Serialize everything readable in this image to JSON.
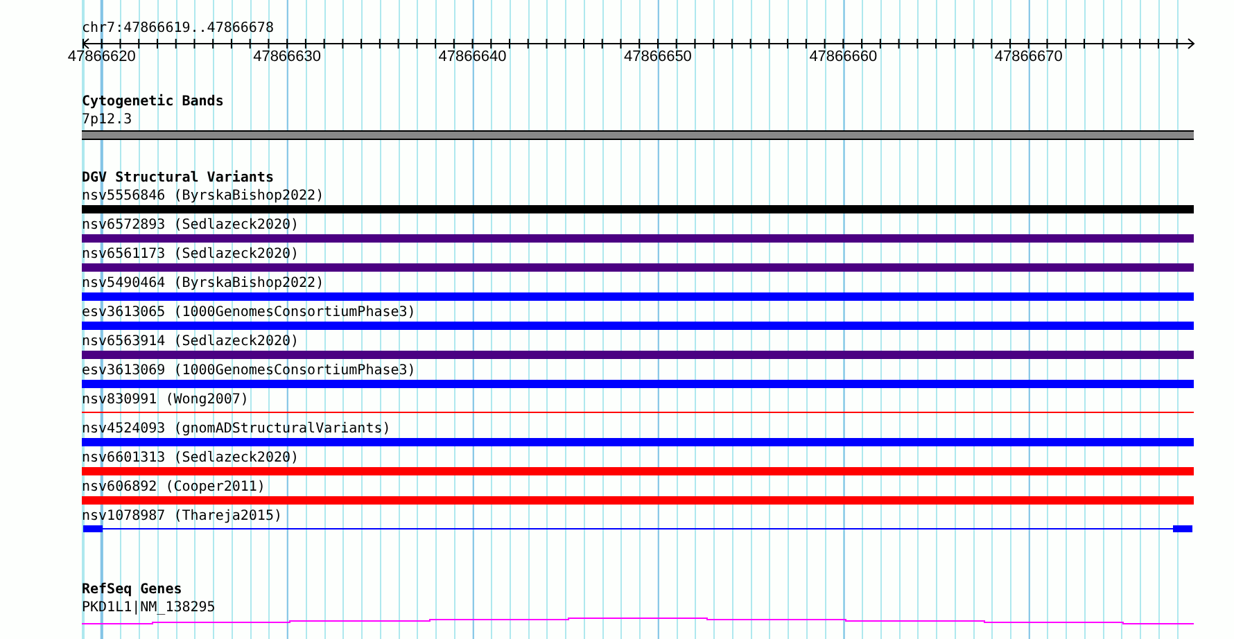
{
  "ruler": {
    "location": "chr7:47866619..47866678",
    "labels": [
      "47866620",
      "47866630",
      "47866640",
      "47866650",
      "47866660",
      "47866670"
    ]
  },
  "cytogenetic_bands": {
    "title": "Cytogenetic Bands",
    "feature": {
      "label": "7p12.3",
      "color": "#888888"
    }
  },
  "dgv_structural_variants": {
    "title": "DGV Structural Variants",
    "features": [
      {
        "label": "nsv5556846 (ByrskaBishop2022)",
        "color": "#000000",
        "kind": "block"
      },
      {
        "label": "nsv6572893 (Sedlazeck2020)",
        "color": "#4b0082",
        "kind": "block"
      },
      {
        "label": "nsv6561173 (Sedlazeck2020)",
        "color": "#4b0082",
        "kind": "block"
      },
      {
        "label": "nsv5490464 (ByrskaBishop2022)",
        "color": "#0000ff",
        "kind": "block"
      },
      {
        "label": "esv3613065 (1000GenomesConsortiumPhase3)",
        "color": "#0000ff",
        "kind": "block"
      },
      {
        "label": "nsv6563914 (Sedlazeck2020)",
        "color": "#4b0082",
        "kind": "block"
      },
      {
        "label": "esv3613069 (1000GenomesConsortiumPhase3)",
        "color": "#0000ff",
        "kind": "block"
      },
      {
        "label": "nsv830991 (Wong2007)",
        "color": "#ff0000",
        "kind": "line"
      },
      {
        "label": "nsv4524093 (gnomADStructuralVariants)",
        "color": "#0000ff",
        "kind": "block"
      },
      {
        "label": "nsv6601313 (Sedlazeck2020)",
        "color": "#ff0000",
        "kind": "block"
      },
      {
        "label": "nsv606892 (Cooper2011)",
        "color": "#ff0000",
        "kind": "block"
      },
      {
        "label": "nsv1078987 (Thareja2015)",
        "color": "#0000ff",
        "kind": "ends"
      }
    ]
  },
  "refseq_genes": {
    "title": "RefSeq Genes",
    "feature": {
      "label": "PKD1L1|NM_138295"
    }
  }
}
